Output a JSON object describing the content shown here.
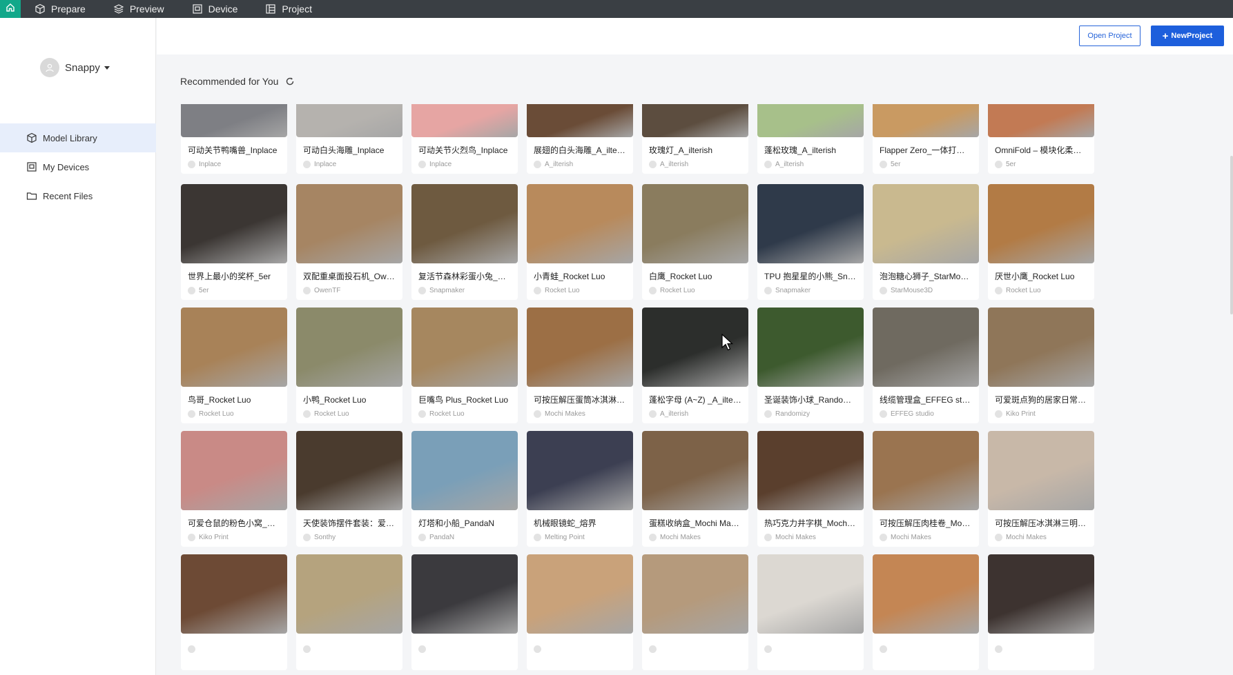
{
  "topbar": {
    "items": [
      {
        "label": "Prepare",
        "icon": "cube-icon"
      },
      {
        "label": "Preview",
        "icon": "layers-icon"
      },
      {
        "label": "Device",
        "icon": "device-icon"
      },
      {
        "label": "Project",
        "icon": "project-icon"
      }
    ],
    "accent": "#12a88a"
  },
  "sidebar": {
    "user": "Snappy",
    "items": [
      {
        "label": "Model Library",
        "icon": "box-icon",
        "active": true
      },
      {
        "label": "My Devices",
        "icon": "printer-icon",
        "active": false
      },
      {
        "label": "Recent Files",
        "icon": "folder-icon",
        "active": false
      }
    ]
  },
  "actions": {
    "open_label": "Open Project",
    "new_label": "NewProject",
    "primary_color": "#1d5fdc"
  },
  "section": {
    "title": "Recommended for You"
  },
  "cards": [
    [
      {
        "title": "可动关节鸭嘴兽_Inplace",
        "author": "Inplace",
        "color": "#7e7f84"
      },
      {
        "title": "可动白头海雕_Inplace",
        "author": "Inplace",
        "color": "#b5b2ae"
      },
      {
        "title": "可动关节火烈鸟_Inplace",
        "author": "Inplace",
        "color": "#e6a5a3"
      },
      {
        "title": "展翅的白头海雕_A_ilterish",
        "author": "A_ilterish",
        "color": "#6a4c37"
      },
      {
        "title": "玫瑰灯_A_ilterish",
        "author": "A_ilterish",
        "color": "#5c4d3f"
      },
      {
        "title": "蓬松玫瑰_A_ilterish",
        "author": "A_ilterish",
        "color": "#a7c08a"
      },
      {
        "title": "Flapper Zero_一体打印折...",
        "author": "5er",
        "color": "#c99a62"
      },
      {
        "title": "OmniFold – 模块化柔性几...",
        "author": "5er",
        "color": "#c27a54"
      }
    ],
    [
      {
        "title": "世界上最小的奖杯_5er",
        "author": "5er",
        "color": "#3b3633"
      },
      {
        "title": "双配重桌面投石机_OwenTF",
        "author": "OwenTF",
        "color": "#a68563"
      },
      {
        "title": "复活节森林彩蛋小兔_Sna...",
        "author": "Snapmaker",
        "color": "#6e5a40"
      },
      {
        "title": "小青蛙_Rocket Luo",
        "author": "Rocket Luo",
        "color": "#b88a5c"
      },
      {
        "title": "白鹰_Rocket Luo",
        "author": "Rocket Luo",
        "color": "#8a7c5e"
      },
      {
        "title": "TPU 抱星星的小熊_Snap...",
        "author": "Snapmaker",
        "color": "#2f3a4a"
      },
      {
        "title": "泡泡糖心狮子_StarMouse...",
        "author": "StarMouse3D",
        "color": "#c9b98f"
      },
      {
        "title": "厌世小鹰_Rocket Luo",
        "author": "Rocket Luo",
        "color": "#b27b45"
      }
    ],
    [
      {
        "title": "鸟哥_Rocket Luo",
        "author": "Rocket Luo",
        "color": "#a88258"
      },
      {
        "title": "小鸭_Rocket Luo",
        "author": "Rocket Luo",
        "color": "#8b8a6a"
      },
      {
        "title": "巨嘴鸟 Plus_Rocket Luo",
        "author": "Rocket Luo",
        "color": "#a6875f"
      },
      {
        "title": "可按压解压蛋筒冰淇淋_M...",
        "author": "Mochi Makes",
        "color": "#9c6f45"
      },
      {
        "title": "蓬松字母 (A~Z) _A_ilter...",
        "author": "A_ilterish",
        "color": "#2c2e2c"
      },
      {
        "title": "圣诞装饰小球_Randomizy",
        "author": "Randomizy",
        "color": "#3d5a2e"
      },
      {
        "title": "线缆管理盒_EFFEG studio",
        "author": "EFFEG studio",
        "color": "#6f6a60"
      },
      {
        "title": "可爱斑点狗的居家日常_Ki...",
        "author": "Kiko Print",
        "color": "#8f7659"
      }
    ],
    [
      {
        "title": "可爱仓鼠的粉色小窝_Kik...",
        "author": "Kiko Print",
        "color": "#c98a86"
      },
      {
        "title": "天使装饰摆件套装：爱心...",
        "author": "Sonthy",
        "color": "#4a3b2e"
      },
      {
        "title": "灯塔和小船_PandaN",
        "author": "PandaN",
        "color": "#7a9fb8"
      },
      {
        "title": "机械眼镜蛇_熔界",
        "author": "Melting Point",
        "color": "#3c3f52"
      },
      {
        "title": "蛋糕收纳盒_Mochi Makes",
        "author": "Mochi Makes",
        "color": "#7d6248"
      },
      {
        "title": "热巧克力井字棋_Mochi M...",
        "author": "Mochi Makes",
        "color": "#5a3f2d"
      },
      {
        "title": "可按压解压肉桂卷_Mochi...",
        "author": "Mochi Makes",
        "color": "#9a7450"
      },
      {
        "title": "可按压解压冰淇淋三明治...",
        "author": "Mochi Makes",
        "color": "#c8b8a8"
      }
    ],
    [
      {
        "title": "",
        "author": "",
        "color": "#6d4a35"
      },
      {
        "title": "",
        "author": "",
        "color": "#b5a37e"
      },
      {
        "title": "",
        "author": "",
        "color": "#3b3a3e"
      },
      {
        "title": "",
        "author": "",
        "color": "#c9a27a"
      },
      {
        "title": "",
        "author": "",
        "color": "#b59a7c"
      },
      {
        "title": "",
        "author": "",
        "color": "#dcd8d2"
      },
      {
        "title": "",
        "author": "",
        "color": "#c48654"
      },
      {
        "title": "",
        "author": "",
        "color": "#3d3330"
      }
    ]
  ]
}
